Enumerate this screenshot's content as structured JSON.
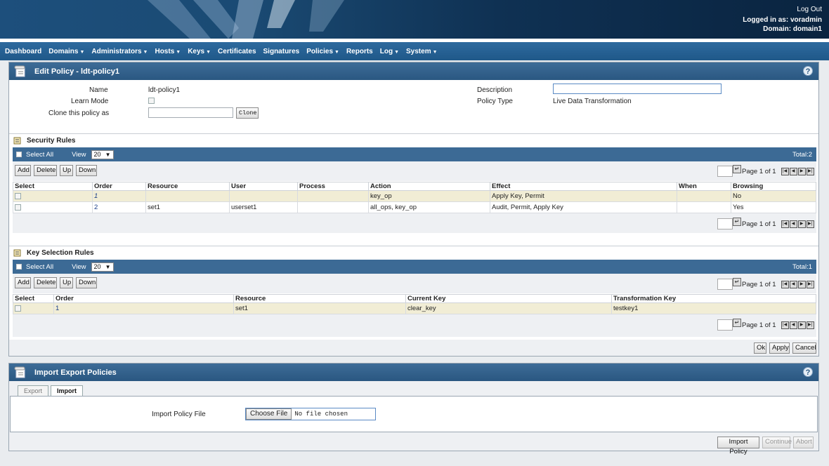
{
  "header": {
    "logout": "Log Out",
    "logged_in_as": "Logged in as: voradmin",
    "domain": "Domain: domain1"
  },
  "nav": {
    "items": [
      {
        "label": "Dashboard",
        "dropdown": false
      },
      {
        "label": "Domains",
        "dropdown": true
      },
      {
        "label": "Administrators",
        "dropdown": true
      },
      {
        "label": "Hosts",
        "dropdown": true
      },
      {
        "label": "Keys",
        "dropdown": true
      },
      {
        "label": "Certificates",
        "dropdown": false
      },
      {
        "label": "Signatures",
        "dropdown": false
      },
      {
        "label": "Policies",
        "dropdown": true
      },
      {
        "label": "Reports",
        "dropdown": false
      },
      {
        "label": "Log",
        "dropdown": true
      },
      {
        "label": "System",
        "dropdown": true
      }
    ]
  },
  "edit_policy": {
    "title": "Edit Policy - ldt-policy1",
    "help": "?",
    "name_label": "Name",
    "name_value": "ldt-policy1",
    "learn_mode_label": "Learn Mode",
    "clone_label": "Clone this policy as",
    "clone_value": "",
    "clone_button": "Clone",
    "description_label": "Description",
    "description_value": "",
    "policy_type_label": "Policy Type",
    "policy_type_value": "Live Data Transformation"
  },
  "security_rules": {
    "title": "Security Rules",
    "select_all": "Select All",
    "view_label": "View",
    "view_value": "20",
    "total": "Total:2",
    "buttons": {
      "add": "Add",
      "delete": "Delete",
      "up": "Up",
      "down": "Down"
    },
    "page_text": "Page 1 of 1",
    "columns": [
      "Select",
      "Order",
      "Resource",
      "User",
      "Process",
      "Action",
      "Effect",
      "When",
      "Browsing"
    ],
    "rows": [
      {
        "order": "1",
        "resource": "",
        "user": "",
        "process": "",
        "action": "key_op",
        "effect": "Apply Key, Permit",
        "when": "",
        "browsing": "No"
      },
      {
        "order": "2",
        "resource": "set1",
        "user": "userset1",
        "process": "",
        "action": "all_ops, key_op",
        "effect": "Audit, Permit, Apply Key",
        "when": "",
        "browsing": "Yes"
      }
    ]
  },
  "key_selection_rules": {
    "title": "Key Selection Rules",
    "select_all": "Select All",
    "view_label": "View",
    "view_value": "20",
    "total": "Total:1",
    "buttons": {
      "add": "Add",
      "delete": "Delete",
      "up": "Up",
      "down": "Down"
    },
    "page_text": "Page 1 of 1",
    "columns": [
      "Select",
      "Order",
      "Resource",
      "Current Key",
      "Transformation Key"
    ],
    "rows": [
      {
        "order": "1",
        "resource": "set1",
        "current_key": "clear_key",
        "transformation_key": "testkey1"
      }
    ]
  },
  "form_buttons": {
    "ok": "Ok",
    "apply": "Apply",
    "cancel": "Cancel"
  },
  "import_export": {
    "title": "Import Export Policies",
    "help": "?",
    "tabs": [
      "Export",
      "Import"
    ],
    "active_tab": "Import",
    "file_label": "Import Policy File",
    "choose_file": "Choose File",
    "no_file": "No file chosen",
    "buttons": {
      "import": "Import Policy",
      "continue": "Continue",
      "abort": "Abort"
    }
  }
}
